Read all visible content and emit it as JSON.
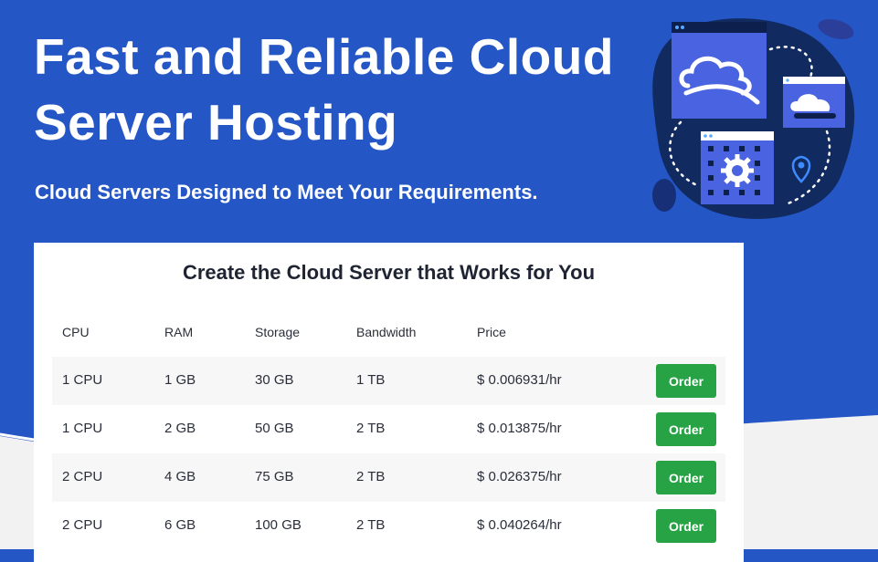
{
  "hero": {
    "title_line1": "Fast and Reliable Cloud",
    "title_line2": "Server Hosting",
    "subtitle": "Cloud Servers Designed to Meet Your Requirements."
  },
  "card": {
    "title": "Create the Cloud Server that Works for You",
    "columns": [
      "CPU",
      "RAM",
      "Storage",
      "Bandwidth",
      "Price"
    ],
    "rows": [
      {
        "cpu": "1 CPU",
        "ram": "1 GB",
        "storage": "30 GB",
        "bandwidth": "1 TB",
        "price": "$ 0.006931/hr",
        "action": "Order"
      },
      {
        "cpu": "1 CPU",
        "ram": "2 GB",
        "storage": "50 GB",
        "bandwidth": "2 TB",
        "price": "$ 0.013875/hr",
        "action": "Order"
      },
      {
        "cpu": "2 CPU",
        "ram": "4 GB",
        "storage": "75 GB",
        "bandwidth": "2 TB",
        "price": "$ 0.026375/hr",
        "action": "Order"
      },
      {
        "cpu": "2 CPU",
        "ram": "6 GB",
        "storage": "100 GB",
        "bandwidth": "2 TB",
        "price": "$ 0.040264/hr",
        "action": "Order"
      }
    ]
  },
  "colors": {
    "hero_background": "#2556c6",
    "order_button": "#27a346",
    "illustration_blob": "#112a60"
  },
  "icons": [
    "cloud-window-icon",
    "cloud-storage-icon",
    "server-rack-icon",
    "gear-icon",
    "location-pin-icon"
  ]
}
